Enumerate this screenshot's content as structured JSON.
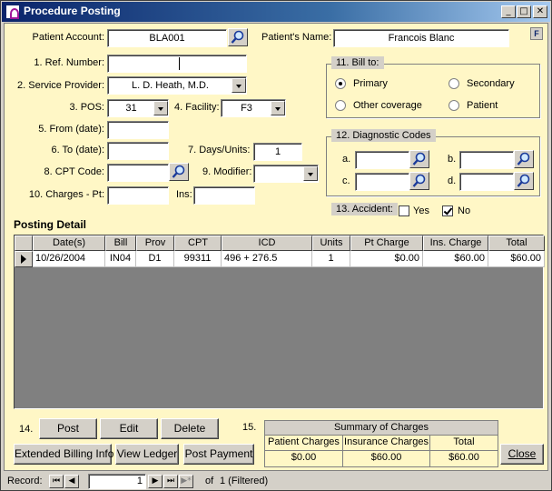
{
  "window": {
    "title": "Procedure Posting",
    "minimize": "_",
    "maximize": "□",
    "close": "✕"
  },
  "help_label": "F",
  "form": {
    "patient_account_label": "Patient Account:",
    "patient_account_value": "BLA001",
    "patient_name_label": "Patient's Name:",
    "patient_name_value": "Francois Blanc",
    "ref_number_label": "1. Ref. Number:",
    "ref_number_value": "",
    "service_provider_label": "2. Service Provider:",
    "service_provider_value": "L. D. Heath, M.D.",
    "pos_label": "3. POS:",
    "pos_value": "31",
    "facility_label": "4. Facility:",
    "facility_value": "F3",
    "from_date_label": "5. From (date):",
    "from_date_value": "",
    "to_date_label": "6. To (date):",
    "to_date_value": "",
    "days_units_label": "7. Days/Units:",
    "days_units_value": "1",
    "cpt_code_label": "8. CPT Code:",
    "cpt_code_value": "",
    "modifier_label": "9. Modifier:",
    "modifier_value": "",
    "charges_pt_label": "10. Charges - Pt:",
    "charges_pt_value": "",
    "ins_label": "Ins:",
    "ins_value": ""
  },
  "bill_to": {
    "title": "11. Bill to:",
    "options": [
      "Primary",
      "Secondary",
      "Other coverage",
      "Patient"
    ],
    "selected": "Primary"
  },
  "diagnostic_codes": {
    "title": "12. Diagnostic Codes",
    "labels": [
      "a.",
      "b.",
      "c.",
      "d."
    ],
    "values": [
      "",
      "",
      "",
      ""
    ]
  },
  "accident": {
    "label": "13. Accident:",
    "yes_label": "Yes",
    "no_label": "No",
    "yes_checked": false,
    "no_checked": true
  },
  "posting_detail": {
    "title": "Posting Detail",
    "columns": [
      "Date(s)",
      "Bill",
      "Prov",
      "CPT",
      "ICD",
      "Units",
      "Pt Charge",
      "Ins. Charge",
      "Total"
    ],
    "rows": [
      [
        "10/26/2004",
        "IN04",
        "D1",
        "99311",
        "496 + 276.5",
        "1",
        "$0.00",
        "$60.00",
        "$60.00"
      ]
    ]
  },
  "actions": {
    "row14_label": "14.",
    "post": "Post",
    "edit": "Edit",
    "delete": "Delete",
    "extended_billing": "Extended Billing Info",
    "view_ledger": "View Ledger",
    "post_payment": "Post Payment",
    "row15_label": "15.",
    "close": "Close"
  },
  "summary": {
    "title": "Summary of Charges",
    "columns": [
      "Patient Charges",
      "Insurance Charges",
      "Total"
    ],
    "values": [
      "$0.00",
      "$60.00",
      "$60.00"
    ]
  },
  "statusbar": {
    "record_label": "Record:",
    "current_record": "1",
    "of_label": "of",
    "total_info": "1 (Filtered)",
    "first": "⏮",
    "prev": "◀",
    "next": "▶",
    "last": "⏭",
    "new": "▶*"
  }
}
